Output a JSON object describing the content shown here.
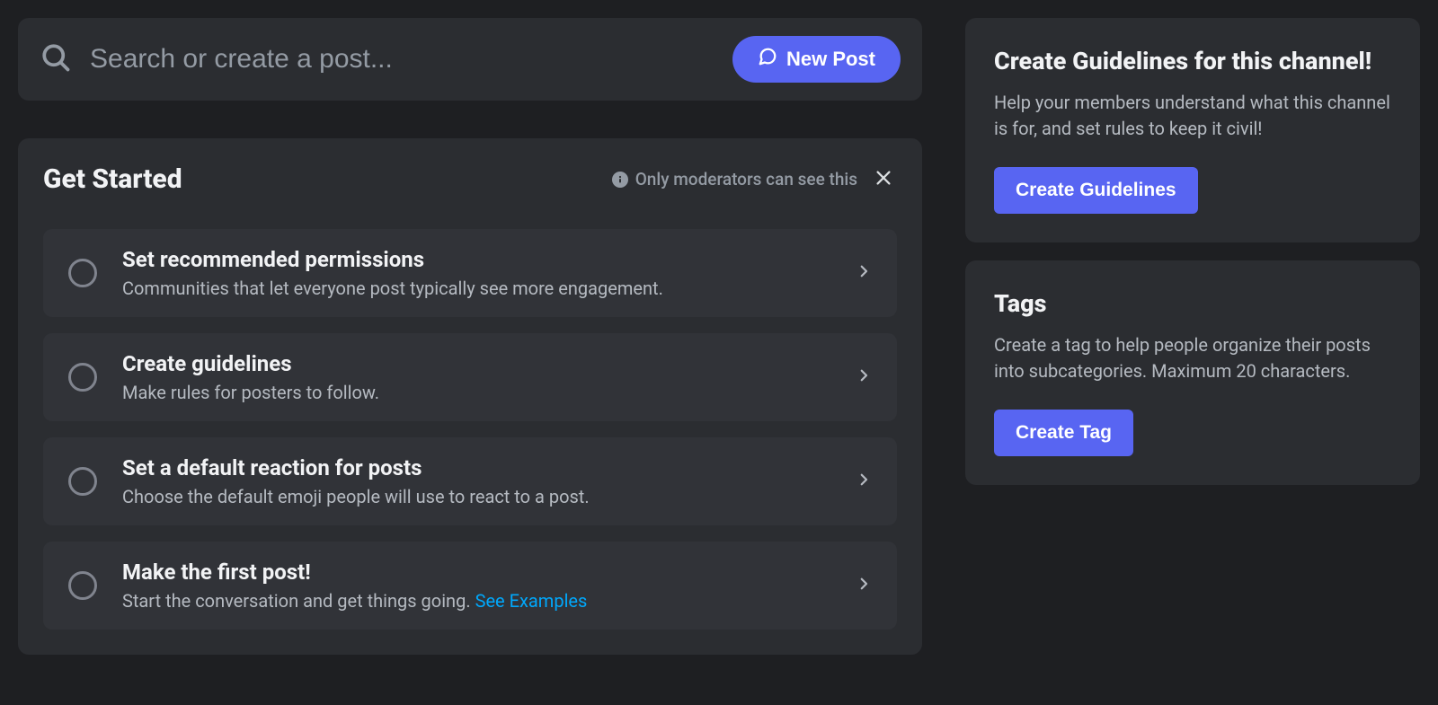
{
  "search": {
    "placeholder": "Search or create a post...",
    "new_post_label": "New Post"
  },
  "get_started": {
    "title": "Get Started",
    "mod_note": "Only moderators can see this",
    "steps": [
      {
        "title": "Set recommended permissions",
        "desc": "Communities that let everyone post typically see more engagement."
      },
      {
        "title": "Create guidelines",
        "desc": "Make rules for posters to follow."
      },
      {
        "title": "Set a default reaction for posts",
        "desc": "Choose the default emoji people will use to react to a post."
      },
      {
        "title": "Make the first post!",
        "desc": "Start the conversation and get things going. ",
        "link": "See Examples"
      }
    ]
  },
  "sidebar": {
    "guidelines": {
      "title": "Create Guidelines for this channel!",
      "desc": "Help your members understand what this channel is for, and set rules to keep it civil!",
      "button": "Create Guidelines"
    },
    "tags": {
      "title": "Tags",
      "desc": "Create a tag to help people organize their posts into subcategories. Maximum 20 characters.",
      "button": "Create Tag"
    }
  }
}
